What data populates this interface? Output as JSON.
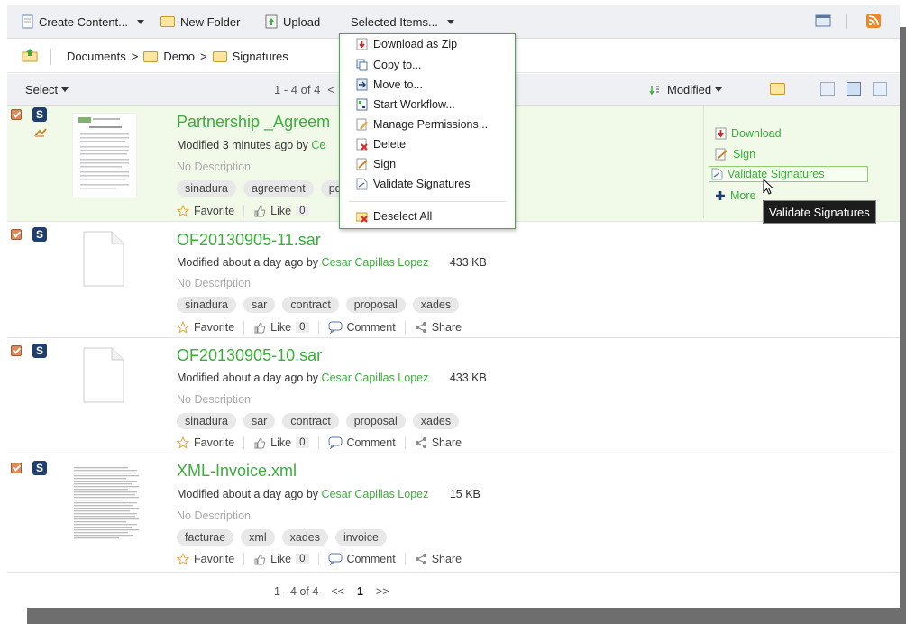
{
  "toolbar": {
    "create_content": "Create Content...",
    "new_folder": "New Folder",
    "upload": "Upload",
    "selected_items": "Selected Items..."
  },
  "breadcrumb": {
    "root": "Documents",
    "sep": ">",
    "level1": "Demo",
    "level2": "Signatures"
  },
  "listbar": {
    "select": "Select",
    "page_info": "1 - 4 of 4",
    "page_prev": "<",
    "sort_field": "Modified"
  },
  "selected_menu": {
    "items": [
      "Download as Zip",
      "Copy to...",
      "Move to...",
      "Start Workflow...",
      "Manage Permissions...",
      "Delete",
      "Sign",
      "Validate Signatures"
    ],
    "deselect_all": "Deselect All"
  },
  "documents": [
    {
      "title": "Partnership _Agreem",
      "modified": "Modified 3 minutes ago by",
      "modifier": "Ce",
      "size": "",
      "description": "No Description",
      "tags": [
        "sinadura",
        "agreement",
        "pd"
      ],
      "favorite": "Favorite",
      "like": "Like",
      "like_count": "0"
    },
    {
      "title": "OF20130905-11.sar",
      "modified": "Modified about a day ago by",
      "modifier": "Cesar Capillas Lopez",
      "size": "433 KB",
      "description": "No Description",
      "tags": [
        "sinadura",
        "sar",
        "contract",
        "proposal",
        "xades"
      ],
      "favorite": "Favorite",
      "like": "Like",
      "like_count": "0",
      "comment": "Comment",
      "share": "Share"
    },
    {
      "title": "OF20130905-10.sar",
      "modified": "Modified about a day ago by",
      "modifier": "Cesar Capillas Lopez",
      "size": "433 KB",
      "description": "No Description",
      "tags": [
        "sinadura",
        "sar",
        "contract",
        "proposal",
        "xades"
      ],
      "favorite": "Favorite",
      "like": "Like",
      "like_count": "0",
      "comment": "Comment",
      "share": "Share"
    },
    {
      "title": "XML-Invoice.xml",
      "modified": "Modified about a day ago by",
      "modifier": "Cesar Capillas Lopez",
      "size": "15 KB",
      "description": "No Description",
      "tags": [
        "facturae",
        "xml",
        "xades",
        "invoice"
      ],
      "favorite": "Favorite",
      "like": "Like",
      "like_count": "0",
      "comment": "Comment",
      "share": "Share"
    }
  ],
  "row_actions": {
    "download": "Download",
    "sign": "Sign",
    "validate": "Validate Signatures",
    "more": "More"
  },
  "tooltip": "Validate Signatures",
  "pager": {
    "info": "1 - 4 of 4",
    "first": "<<",
    "current": "1",
    "next": ">>"
  },
  "colors": {
    "accent_green": "#3bad3b",
    "selected_row": "#f1f9e9",
    "toolbar_bg": "#eef0f3"
  }
}
